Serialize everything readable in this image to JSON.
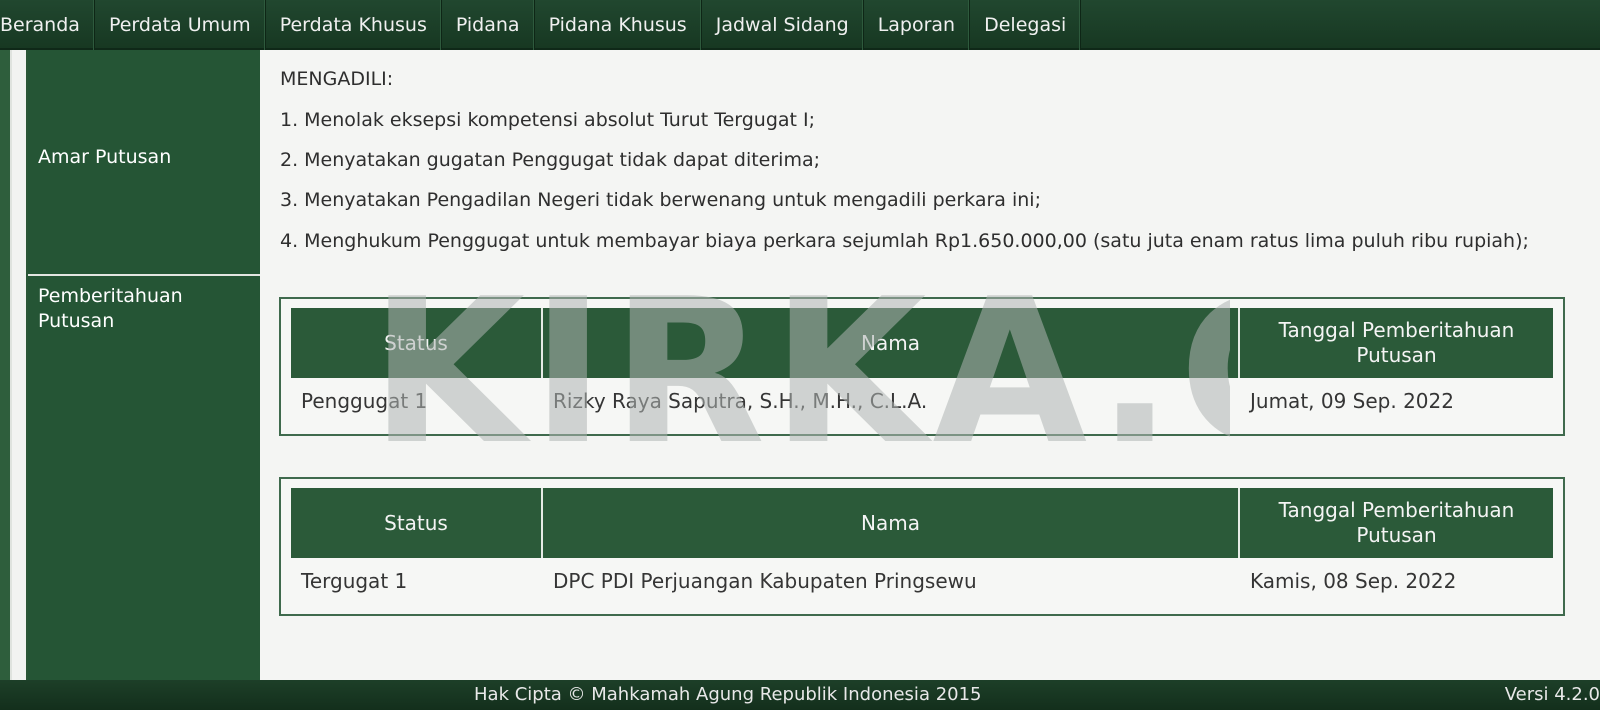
{
  "nav": {
    "items": [
      "Beranda",
      "Perdata Umum",
      "Perdata Khusus",
      "Pidana",
      "Pidana Khusus",
      "Jadwal Sidang",
      "Laporan",
      "Delegasi"
    ]
  },
  "labels": {
    "amar_putusan": "Amar Putusan",
    "pemberitahuan_line1": "Pemberitahuan",
    "pemberitahuan_line2": "Putusan"
  },
  "amar": {
    "heading": "MENGADILI:",
    "items": [
      "1. Menolak eksepsi kompetensi absolut Turut Tergugat I;",
      "2. Menyatakan gugatan Penggugat tidak dapat diterima;",
      "3. Menyatakan Pengadilan Negeri tidak berwenang untuk mengadili perkara ini;",
      "4. Menghukum Penggugat untuk membayar biaya perkara sejumlah Rp1.650.000,00 (satu juta enam ratus lima puluh ribu rupiah);"
    ]
  },
  "tables": [
    {
      "headers": {
        "status": "Status",
        "nama": "Nama",
        "tanggal_line1": "Tanggal Pemberitahuan",
        "tanggal_line2": "Putusan"
      },
      "row": {
        "status": "Penggugat 1",
        "nama": "Rizky Raya Saputra, S.H., M.H., C.L.A.",
        "tanggal": "Jumat, 09 Sep. 2022"
      }
    },
    {
      "headers": {
        "status": "Status",
        "nama": "Nama",
        "tanggal_line1": "Tanggal Pemberitahuan",
        "tanggal_line2": "Putusan"
      },
      "row": {
        "status": "Tergugat 1",
        "nama": "DPC PDI Perjuangan Kabupaten Pringsewu",
        "tanggal": "Kamis, 08 Sep. 2022"
      }
    }
  ],
  "watermark": "KIRKA.CO",
  "footer": {
    "copyright": "Hak Cipta © Mahkamah Agung Republik Indonesia 2015",
    "version": "Versi 4.2.0"
  },
  "colors": {
    "nav_bg": "#1f432c",
    "label_bg": "#255535",
    "table_header_bg": "#2b5a39"
  }
}
